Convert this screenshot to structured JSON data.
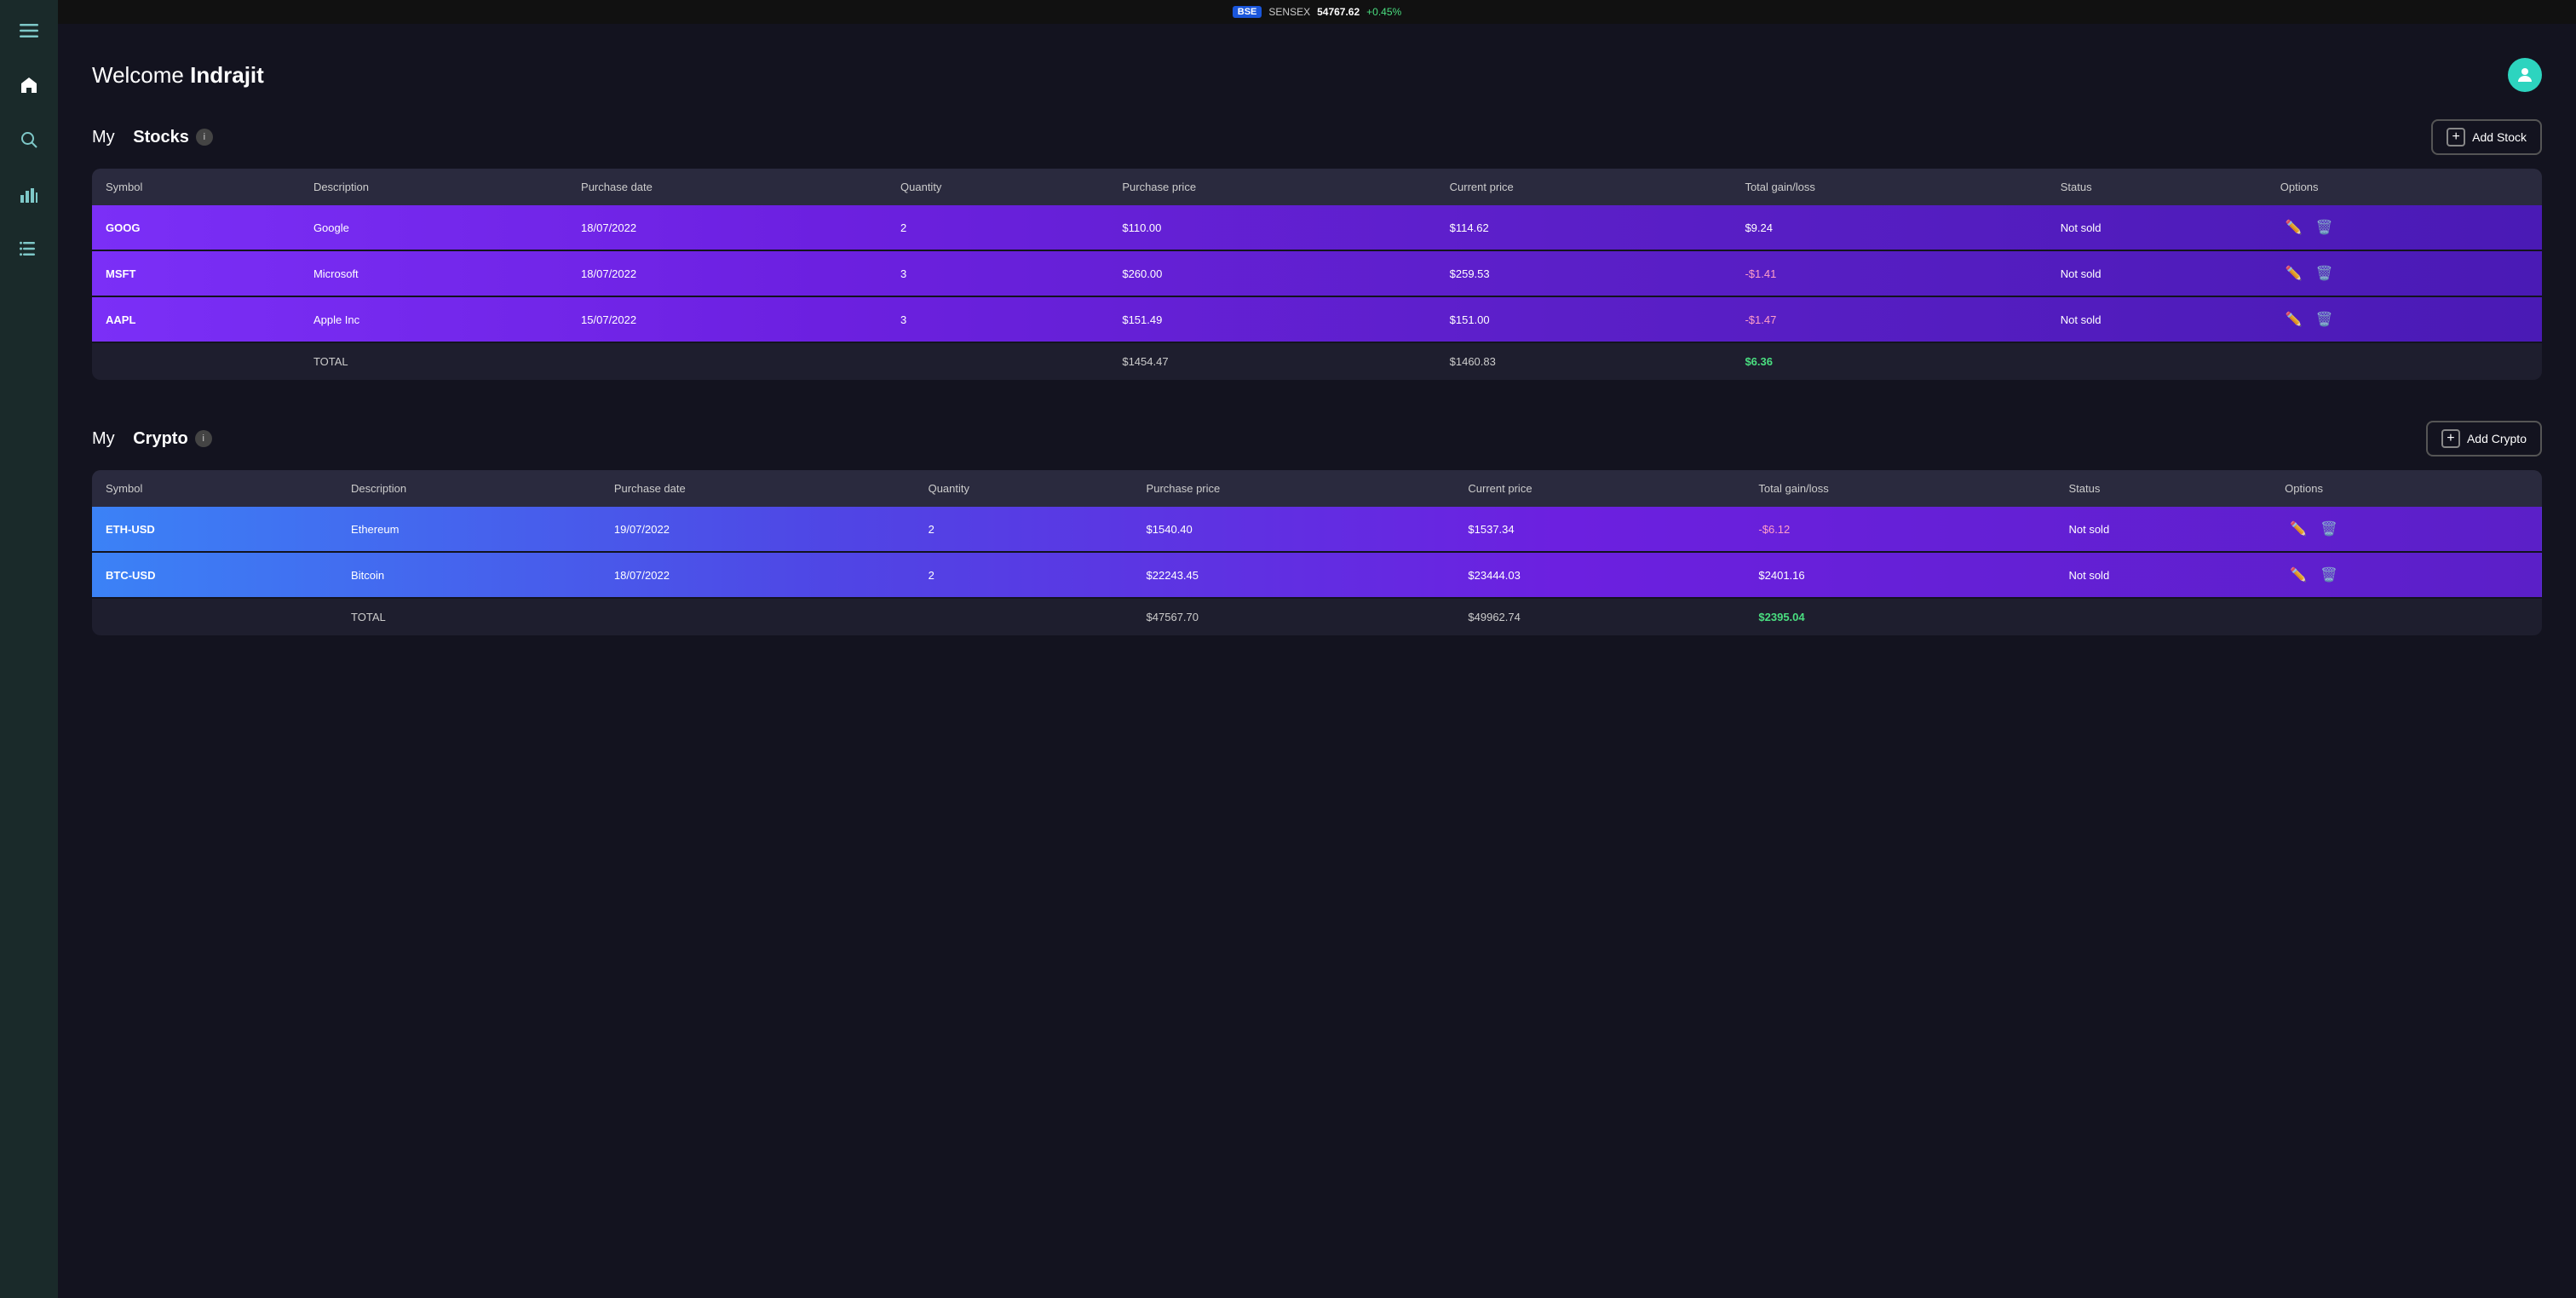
{
  "ticker": {
    "exchange": "BSE",
    "name": "SENSEX",
    "value": "54767.62",
    "change": "+0.45%"
  },
  "header": {
    "welcome_text": "Welcome",
    "username": "Indrajit"
  },
  "sidebar": {
    "icons": [
      {
        "name": "menu-icon",
        "symbol": "☰"
      },
      {
        "name": "home-icon",
        "symbol": "⌂"
      },
      {
        "name": "search-icon",
        "symbol": "🔍"
      },
      {
        "name": "chart-icon",
        "symbol": "📊"
      },
      {
        "name": "list-icon",
        "symbol": "📋"
      }
    ]
  },
  "stocks_section": {
    "title_normal": "My",
    "title_bold": "Stocks",
    "add_label": "Add Stock",
    "table": {
      "headers": [
        "Symbol",
        "Description",
        "Purchase date",
        "Quantity",
        "Purchase price",
        "Current price",
        "Total gain/loss",
        "Status",
        "Options"
      ],
      "rows": [
        {
          "symbol": "GOOG",
          "description": "Google",
          "purchase_date": "18/07/2022",
          "quantity": "2",
          "purchase_price": "$110.00",
          "current_price": "$114.62",
          "total_gain": "$9.24",
          "gain_class": "positive",
          "status": "Not sold"
        },
        {
          "symbol": "MSFT",
          "description": "Microsoft",
          "purchase_date": "18/07/2022",
          "quantity": "3",
          "purchase_price": "$260.00",
          "current_price": "$259.53",
          "total_gain": "-$1.41",
          "gain_class": "negative",
          "status": "Not sold"
        },
        {
          "symbol": "AAPL",
          "description": "Apple Inc",
          "purchase_date": "15/07/2022",
          "quantity": "3",
          "purchase_price": "$151.49",
          "current_price": "$151.00",
          "total_gain": "-$1.47",
          "gain_class": "negative",
          "status": "Not sold"
        }
      ],
      "total": {
        "label": "TOTAL",
        "purchase_price": "$1454.47",
        "current_price": "$1460.83",
        "total_gain": "$6.36"
      }
    }
  },
  "crypto_section": {
    "title_normal": "My",
    "title_bold": "Crypto",
    "add_label": "Add Crypto",
    "table": {
      "headers": [
        "Symbol",
        "Description",
        "Purchase date",
        "Quantity",
        "Purchase price",
        "Current price",
        "Total gain/loss",
        "Status",
        "Options"
      ],
      "rows": [
        {
          "symbol": "ETH-USD",
          "description": "Ethereum",
          "purchase_date": "19/07/2022",
          "quantity": "2",
          "purchase_price": "$1540.40",
          "current_price": "$1537.34",
          "total_gain": "-$6.12",
          "gain_class": "negative",
          "status": "Not sold"
        },
        {
          "symbol": "BTC-USD",
          "description": "Bitcoin",
          "purchase_date": "18/07/2022",
          "quantity": "2",
          "purchase_price": "$22243.45",
          "current_price": "$23444.03",
          "total_gain": "$2401.16",
          "gain_class": "positive",
          "status": "Not sold"
        }
      ],
      "total": {
        "label": "TOTAL",
        "purchase_price": "$47567.70",
        "current_price": "$49962.74",
        "total_gain": "$2395.04"
      }
    }
  }
}
